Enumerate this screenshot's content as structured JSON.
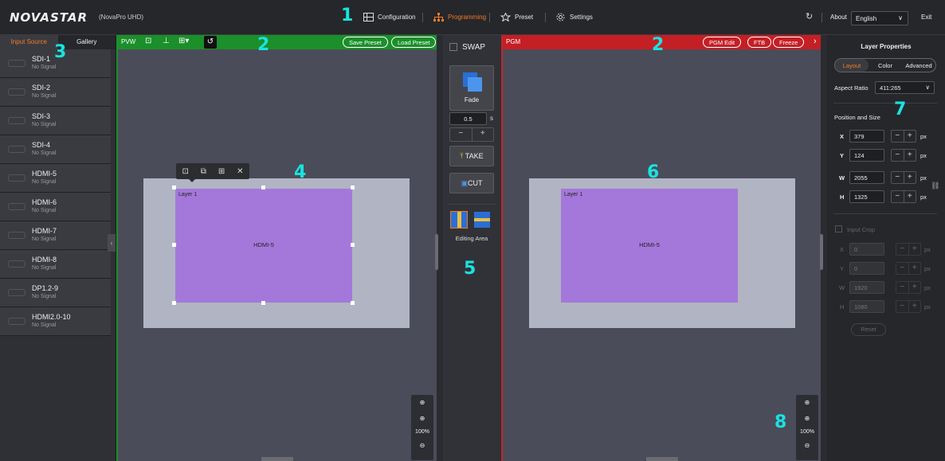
{
  "app": {
    "logo": "NOVASTAR",
    "subtitle": "(NovaPro UHD)"
  },
  "nav": {
    "configuration": "Configuration",
    "programming": "Programming",
    "preset": "Preset",
    "settings": "Settings"
  },
  "topright": {
    "about": "About",
    "language": "English",
    "exit": "Exit"
  },
  "markers": {
    "m1": "1",
    "m2a": "2",
    "m2b": "2",
    "m3": "3",
    "m4": "4",
    "m5": "5",
    "m6": "6",
    "m7": "7",
    "m8": "8"
  },
  "sidebar": {
    "tabs": [
      "Input Source",
      "Gallery"
    ],
    "items": [
      {
        "name": "SDI-1",
        "status": "No Signal"
      },
      {
        "name": "SDI-2",
        "status": "No Signal"
      },
      {
        "name": "SDI-3",
        "status": "No Signal"
      },
      {
        "name": "SDI-4",
        "status": "No Signal"
      },
      {
        "name": "HDMI-5",
        "status": "No Signal"
      },
      {
        "name": "HDMI-6",
        "status": "No Signal"
      },
      {
        "name": "HDMI-7",
        "status": "No Signal"
      },
      {
        "name": "HDMI-8",
        "status": "No Signal"
      },
      {
        "name": "DP1.2-9",
        "status": "No Signal"
      },
      {
        "name": "HDMI2.0-10",
        "status": "No Signal"
      }
    ]
  },
  "pvw": {
    "label": "PVW",
    "save_preset": "Save Preset",
    "load_preset": "Load Preset",
    "layer_name": "Layer 1",
    "layer_source": "HDMI-5",
    "zoom": "100%"
  },
  "pgm": {
    "label": "PGM",
    "pgm_edit": "PGM Edit",
    "ftb": "FTB",
    "freeze": "Freeze",
    "layer_name": "Layer 1",
    "layer_source": "HDMI-5",
    "zoom": "100%"
  },
  "middle": {
    "swap": "SWAP",
    "effect": "Fade",
    "duration": "0.5",
    "unit": "s",
    "take": "TAKE",
    "cut": "CUT",
    "editing_area": "Editing Area"
  },
  "props": {
    "title": "Layer Properties",
    "tabs": [
      "Layout",
      "Color",
      "Advanced"
    ],
    "aspect_label": "Aspect Ratio",
    "aspect_value": "411:265",
    "pos_title": "Position and Size",
    "x": "379",
    "y": "124",
    "w": "2055",
    "h": "1325",
    "unit": "px",
    "input_crop": "Input Crop",
    "crop_x": "0",
    "crop_y": "0",
    "crop_w": "1920",
    "crop_h": "1080",
    "reset": "Reset"
  },
  "colors": {
    "pvw": "#1b8f2a",
    "pgm": "#c41f25",
    "accent": "#f07b28",
    "layer": "#a478da",
    "marker": "#19e3e0"
  }
}
